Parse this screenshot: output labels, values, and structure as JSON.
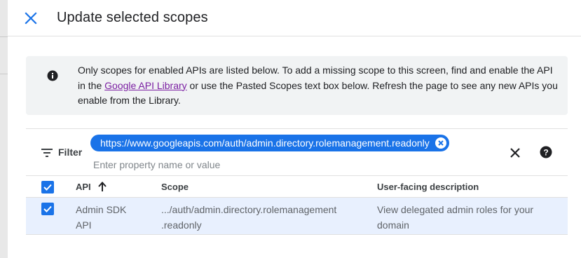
{
  "dialog": {
    "title": "Update selected scopes",
    "close_icon": "close-icon"
  },
  "info": {
    "icon": "info-icon",
    "text_before": "Only scopes for enabled APIs are listed below. To add a missing scope to this screen, find and enable the API in the ",
    "link_text": "Google API Library",
    "text_after": " or use the Pasted Scopes text box below. Refresh the page to see any new APIs you enable from the Library."
  },
  "filter": {
    "icon": "filter-icon",
    "label": "Filter",
    "chip_value": "https://www.googleapis.com/auth/admin.directory.rolemanagement.readonly",
    "chip_remove_icon": "cancel-circle-icon",
    "input_value": "",
    "input_placeholder": "Enter property name or value",
    "clear_icon": "close-icon",
    "help_icon": "help-icon"
  },
  "table": {
    "header_checkbox_checked": true,
    "columns": {
      "api": "API",
      "scope": "Scope",
      "description": "User-facing description"
    },
    "sort_icon": "arrow-upward-icon",
    "rows": [
      {
        "checked": true,
        "api": [
          "Admin SDK",
          "API"
        ],
        "scope": [
          ".../auth/admin.directory.rolemanagement",
          ".readonly"
        ],
        "description": [
          "View delegated admin roles for your",
          "domain"
        ]
      }
    ]
  },
  "colors": {
    "accent": "#1a73e8",
    "info_background": "#f1f3f4",
    "selected_row": "#e8f0fe",
    "link": "#7b1fa2"
  }
}
